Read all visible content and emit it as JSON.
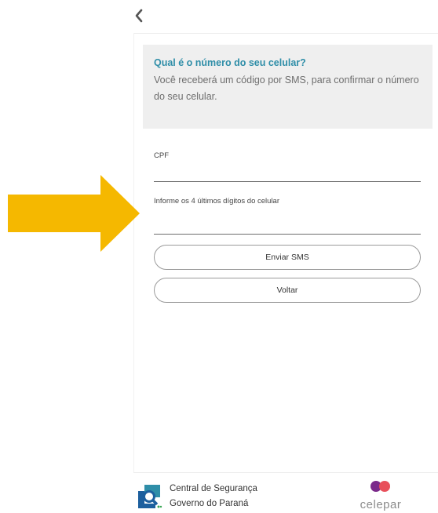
{
  "header": {
    "back_icon": "chevron-left-icon"
  },
  "info": {
    "title": "Qual é o número do seu celular?",
    "text": "Você receberá um código por SMS, para confirmar o número do seu celular."
  },
  "form": {
    "cpf_label": "CPF",
    "cpf_value": "",
    "phone_label": "Informe os 4 últimos dígitos do celular",
    "phone_value": ""
  },
  "buttons": {
    "send": "Enviar SMS",
    "back": "Voltar"
  },
  "footer": {
    "org_line1": "Central de Segurança",
    "org_line2": "Governo do Paraná",
    "partner": "celepar"
  },
  "colors": {
    "accent": "#2f8ea8",
    "arrow": "#f5b800",
    "celepar_dot1": "#7a2a8a",
    "celepar_dot2": "#e8505b",
    "logo_blue": "#1d5f9e",
    "logo_green": "#3aa655"
  }
}
